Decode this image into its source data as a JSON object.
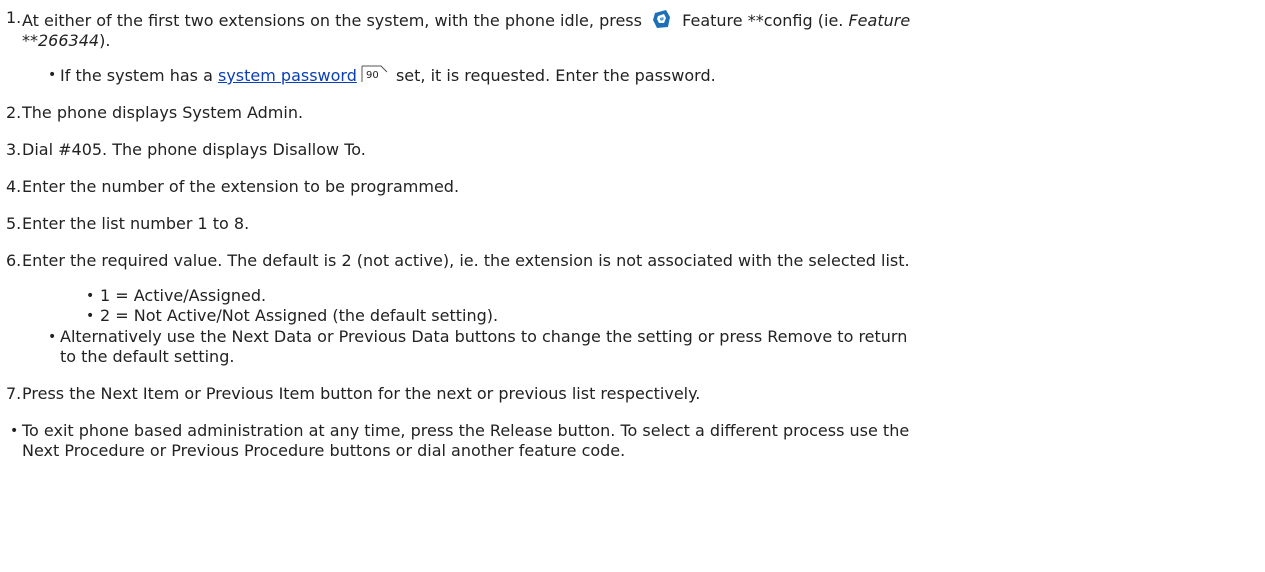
{
  "steps": [
    {
      "num": "1.",
      "pre": "At either of the first two extensions on the system, with the phone idle, press",
      "icon": "feature-key-icon",
      "post": "Feature **config (ie.",
      "italic": "Feature",
      "italic_line2": "**266344",
      "end": ")."
    },
    {
      "num": "2.",
      "text": "The phone displays System Admin."
    },
    {
      "num": "3.",
      "text": "Dial #405. The phone displays Disallow To."
    },
    {
      "num": "4.",
      "text": "Enter the number of the extension to be programmed."
    },
    {
      "num": "5.",
      "text": "Enter the list number 1 to 8."
    },
    {
      "num": "6.",
      "text": "Enter the required value. The default is 2 (not active), ie. the extension is not associated with the selected list."
    },
    {
      "num": "7.",
      "text": "Press the Next Item or Previous Item button for the next or previous list respectively."
    }
  ],
  "step1_bullet": {
    "pre": "If the system has a",
    "link": "system password",
    "ref": "90",
    "post": "set, it is requested. Enter the password."
  },
  "step6_subbullets": [
    "1 = Active/Assigned.",
    "2 = Not Active/Not Assigned (the default setting)."
  ],
  "step6_bullet": {
    "line1": "Alternatively use the Next Data or Previous Data buttons to change the setting or press Remove to return",
    "line2": "to the default setting."
  },
  "final_bullet": {
    "line1": "To exit phone based administration at any time, press the Release button. To select a different process use the",
    "line2": "Next Procedure or Previous Procedure buttons or dial another feature code."
  },
  "colors": {
    "link": "#0b3fb8",
    "icon_primary": "#1f6fb8"
  }
}
